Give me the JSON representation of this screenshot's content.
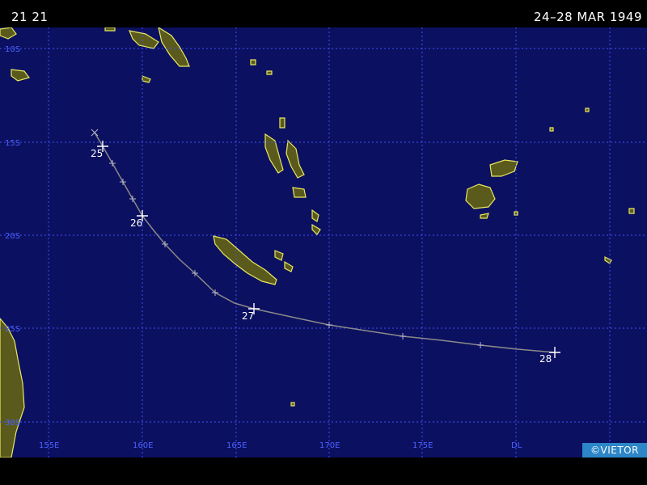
{
  "header": {
    "storm_id": "21 21",
    "date_range": "24–28 MAR 1949"
  },
  "map": {
    "latitude_labels": [
      "10S",
      "15S",
      "20S",
      "25S",
      "30S"
    ],
    "longitude_labels": [
      "155E",
      "160E",
      "165E",
      "170E",
      "175E",
      "DL"
    ],
    "land_color": "#5a5a1c",
    "coast_color": "#e8e860",
    "ocean_color": "#0c1060",
    "grid_color": "#3a52ff"
  },
  "track": {
    "day_labels": [
      "25",
      "26",
      "27",
      "28"
    ],
    "line_color": "#8a8a8a"
  },
  "credit": "©VIETOR"
}
